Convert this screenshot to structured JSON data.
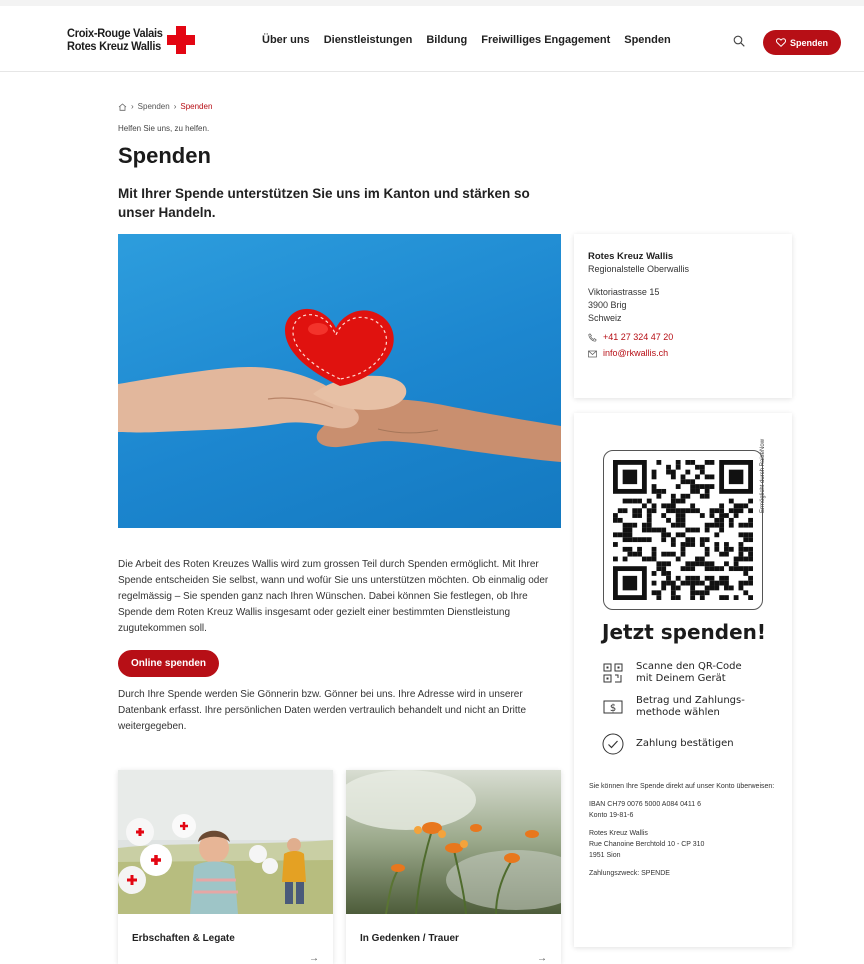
{
  "header": {
    "logo_line1": "Croix-Rouge Valais",
    "logo_line2": "Rotes Kreuz Wallis",
    "nav": [
      "Über uns",
      "Dienstleistungen",
      "Bildung",
      "Freiwilliges Engagement",
      "Spenden"
    ],
    "donate_label": "Spenden"
  },
  "breadcrumb": {
    "items": [
      "Spenden",
      "Spenden"
    ]
  },
  "intro": {
    "kicker": "Helfen Sie uns, zu helfen.",
    "title": "Spenden",
    "lead": "Mit Ihrer Spende unterstützen Sie uns im Kanton und stärken so unser Handeln."
  },
  "main": {
    "paragraph1": "Die Arbeit des Roten Kreuzes Wallis wird zum grossen Teil durch Spenden ermöglicht. Mit Ihrer Spende entscheiden Sie selbst, wann und wofür Sie uns unterstützen möchten. Ob einmalig oder regelmässig – Sie spenden ganz nach Ihren Wünschen. Dabei können Sie festlegen, ob Ihre Spende dem Roten Kreuz Wallis insgesamt oder gezielt einer bestimmten Dienstleistung zugutekommen soll.",
    "online_button": "Online spenden",
    "paragraph2": "Durch Ihre Spende werden Sie Gönnerin bzw. Gönner bei uns. Ihre Adresse wird in unserer Datenbank erfasst. Ihre persönlichen Daten werden vertraulich behandelt und nicht an Dritte weitergegeben."
  },
  "cards": [
    {
      "label": "Erbschaften & Legate",
      "arrow": "→"
    },
    {
      "label": "In Gedenken / Trauer",
      "arrow": "→"
    }
  ],
  "contact": {
    "org": "Rotes Kreuz Wallis",
    "unit": "Regionalstelle Oberwallis",
    "street": "Viktoriastrasse 15",
    "city": "3900 Brig",
    "country": "Schweiz",
    "phone": "+41 27 324 47 20",
    "email": "info@rkwallis.ch"
  },
  "donate_box": {
    "qr_side": "Ermöglicht durch RaiseNow",
    "heading": "Jetzt spenden!",
    "steps": [
      {
        "line1": "Scanne den QR-Code",
        "line2": "mit Deinem Gerät"
      },
      {
        "line1": "Betrag und Zahlungs-",
        "line2": "methode wählen"
      },
      {
        "line1": "Zahlung bestätigen",
        "line2": ""
      }
    ],
    "bank_intro": "Sie können Ihre Spende direkt auf unser Konto überweisen:",
    "iban": "IBAN CH79 0076 5000 A084 0411 6",
    "konto": "Konto 19-81-6",
    "addr1": "Rotes Kreuz Wallis",
    "addr2": "Rue Chanoine Berchtold 10 - CP 310",
    "addr3": "1951 Sion",
    "purpose": "Zahlungszweck: SPENDE"
  },
  "colors": {
    "accent": "#b70f16",
    "cross": "#e30613"
  }
}
